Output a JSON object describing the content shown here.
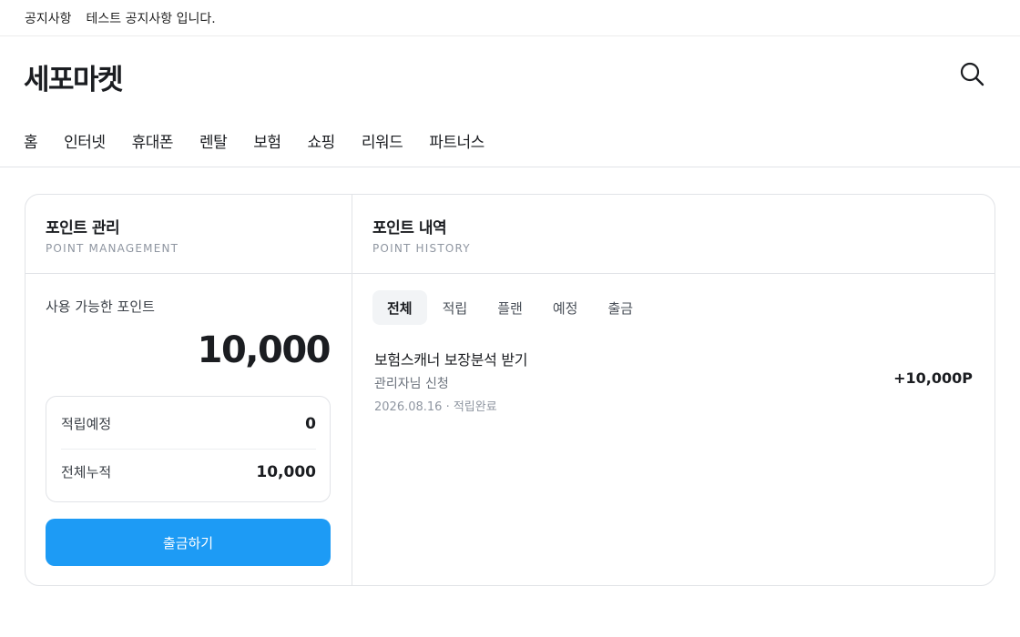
{
  "notice": {
    "label": "공지사항",
    "text": "테스트 공지사항 입니다."
  },
  "brand": "세포마켓",
  "header": {
    "search_icon": "search-icon"
  },
  "nav": {
    "items": [
      {
        "label": "홈"
      },
      {
        "label": "인터넷"
      },
      {
        "label": "휴대폰"
      },
      {
        "label": "렌탈"
      },
      {
        "label": "보험"
      },
      {
        "label": "쇼핑"
      },
      {
        "label": "리워드"
      },
      {
        "label": "파트너스"
      }
    ]
  },
  "management": {
    "title": "포인트 관리",
    "subtitle": "POINT MANAGEMENT",
    "available_label": "사용 가능한 포인트",
    "available_value": "10,000",
    "pending_label": "적립예정",
    "pending_value": "0",
    "total_label": "전체누적",
    "total_value": "10,000",
    "withdraw_button": "출금하기"
  },
  "history": {
    "title": "포인트 내역",
    "subtitle": "POINT HISTORY",
    "tabs": [
      {
        "label": "전체",
        "active": true
      },
      {
        "label": "적립",
        "active": false
      },
      {
        "label": "플랜",
        "active": false
      },
      {
        "label": "예정",
        "active": false
      },
      {
        "label": "출금",
        "active": false
      }
    ],
    "items": [
      {
        "title": "보험스캐너 보장분석 받기",
        "subtitle": "관리자님 신청",
        "meta": "2026.08.16 · 적립완료",
        "amount": "+10,000P"
      }
    ]
  },
  "colors": {
    "accent": "#1d9bf5",
    "border": "#e1e3e7",
    "text_primary": "#1b1d21",
    "text_muted": "#8f96a1",
    "tab_active_bg": "#f2f4f6"
  }
}
